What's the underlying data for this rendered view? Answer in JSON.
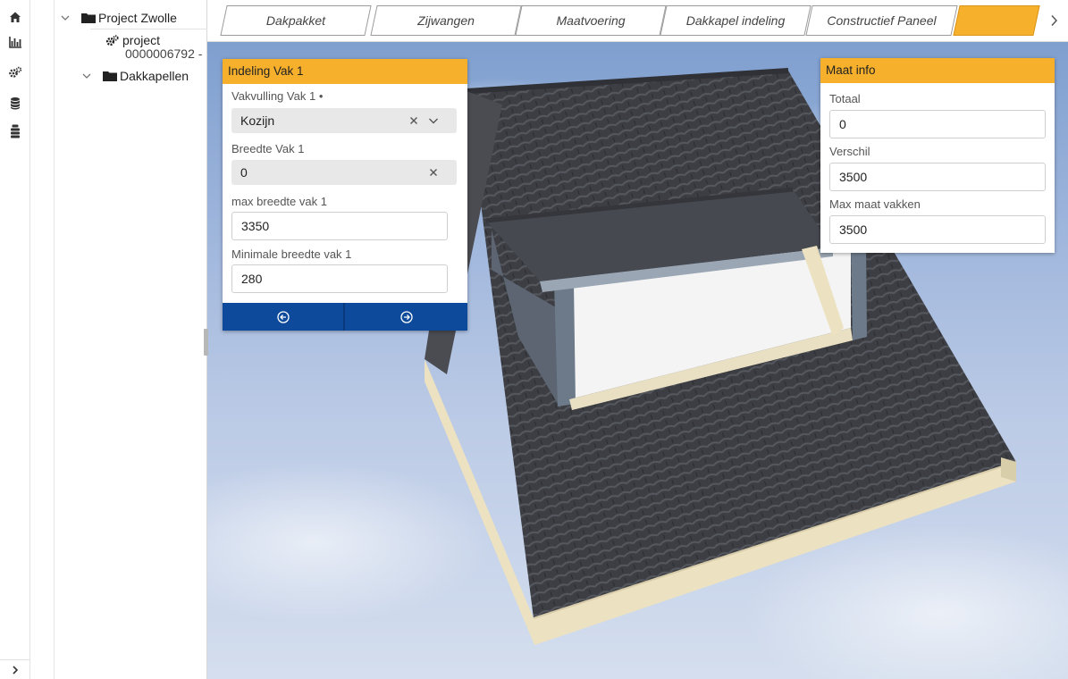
{
  "rail": {
    "icons": [
      "home-icon",
      "chart-icon",
      "gears-icon",
      "database-icon",
      "database-stack-icon"
    ]
  },
  "tree": {
    "root_label": "Project Zwolle",
    "project_label": "project",
    "project_number": "0000006792 -",
    "folder_label": "Dakkapellen"
  },
  "tabs": [
    {
      "label": "Dakpakket"
    },
    {
      "label": "Zijwangen"
    },
    {
      "label": "Maatvoering"
    },
    {
      "label": "Dakkapel indeling"
    },
    {
      "label": "Constructief Paneel"
    },
    {
      "label": ""
    }
  ],
  "indeling_panel": {
    "title": "Indeling Vak 1",
    "vakvulling_label": "Vakvulling Vak 1",
    "vakvulling_required_mark": "•",
    "vakvulling_value": "Kozijn",
    "breedte_label": "Breedte Vak 1",
    "breedte_value": "0",
    "max_breedte_label": "max breedte vak 1",
    "max_breedte_value": "3350",
    "min_breedte_label": "Minimale breedte vak 1",
    "min_breedte_value": "280"
  },
  "maat_panel": {
    "title": "Maat info",
    "totaal_label": "Totaal",
    "totaal_value": "0",
    "verschil_label": "Verschil",
    "verschil_value": "3500",
    "max_maat_label": "Max maat vakken",
    "max_maat_value": "3500"
  },
  "colors": {
    "accent": "#f6b02c",
    "nav_blue": "#0d4a9b",
    "roof_tile": "#3b3d42",
    "fascia": "#efe6c8"
  }
}
